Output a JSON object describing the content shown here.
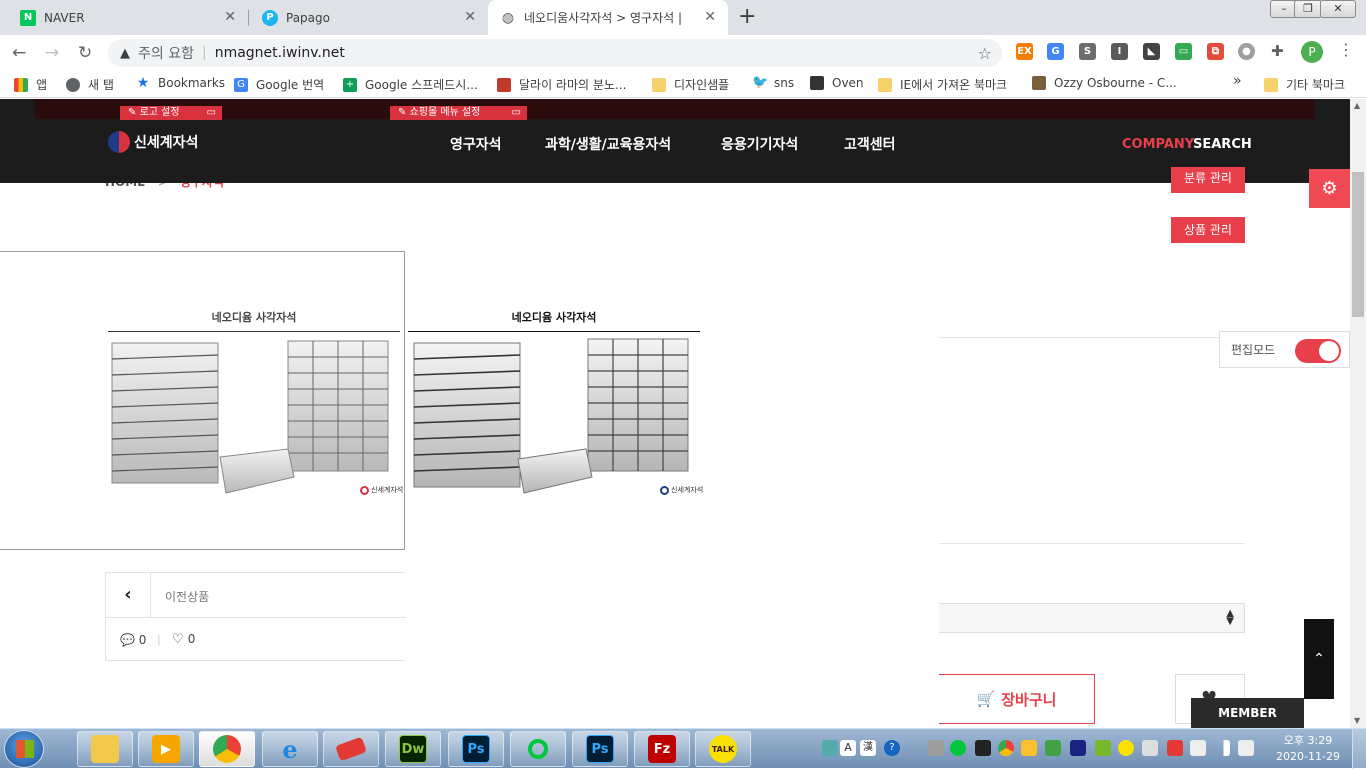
{
  "browser": {
    "tabs": [
      {
        "title": "NAVER",
        "icon": "naver-icon"
      },
      {
        "title": "Papago",
        "icon": "papago-icon"
      },
      {
        "title": "네오디움사각자석 > 영구자석 |",
        "icon": "globe-icon",
        "active": true
      }
    ],
    "new_tab": "+",
    "address": {
      "warning": "주의 요함",
      "url": "nmagnet.iwinv.net"
    },
    "profile_initial": "P",
    "bookmarks": [
      "앱",
      "새 탭",
      "Bookmarks",
      "Google 번역",
      "Google 스프레드시...",
      "달라이 라마의 분노...",
      "디자인샘플",
      "sns",
      "Oven",
      "IE에서 가져온 북마크",
      "Ozzy Osbourne - C..."
    ],
    "bookmarks_more": "»",
    "other_bookmarks": "기타 북마크"
  },
  "site": {
    "edit_bar": {
      "logo_setting": "로고 설정",
      "menu_setting": "쇼핑몰 메뉴 설정"
    },
    "logo_text": "신세계자석",
    "menu": [
      "영구자석",
      "과학/생활/교육용자석",
      "응용기기자석",
      "고객센터"
    ],
    "company": "COMPANY",
    "search": "SEARCH",
    "breadcrumb_home": "HOME",
    "breadcrumb_sep": ">",
    "breadcrumb_current": "영구자석",
    "manage_btn_top": "분류 관리",
    "manage_btn": "상품 관리",
    "edit_mode_label": "편집모드",
    "product_title_left": "네오디윰 사각자석",
    "product_title_right": "네오디윰 사각자석",
    "watermark": "신세계자석",
    "prev_label": "이전상품",
    "comment_count": "0",
    "like_count": "0",
    "cart_button": "장바구니",
    "member_button": "MEMBER",
    "colors": {
      "accent": "#e8404b",
      "header_bg": "#1c1c1c"
    }
  },
  "taskbar": {
    "time": "오후 3:29",
    "date": "2020-11-29",
    "apps": [
      "explorer-icon",
      "media-icon",
      "chrome-icon",
      "ie-icon",
      "eraser-icon",
      "dreamweaver-icon",
      "photoshop-icon",
      "green-dot-icon",
      "photoshop-icon-2",
      "filezilla-icon",
      "kakaotalk-icon"
    ],
    "dw_label": "Dw",
    "ps_label": "Ps",
    "fz_label": "Fz",
    "talk_label": "TALK"
  }
}
